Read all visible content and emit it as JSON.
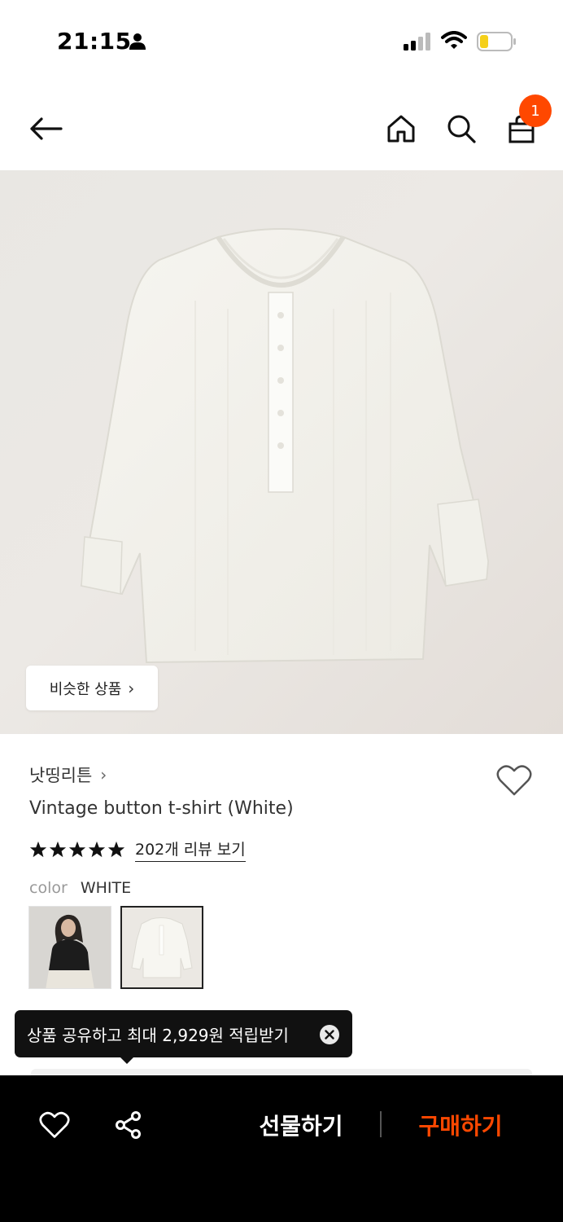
{
  "status_bar": {
    "time": "21:15",
    "icons": [
      "person-icon",
      "signal-icon",
      "wifi-icon",
      "battery-icon"
    ]
  },
  "nav": {
    "icons": [
      "back-arrow-icon",
      "home-icon",
      "search-icon",
      "shopping-bag-icon"
    ],
    "cart_badge": "1"
  },
  "product": {
    "similar_label": "비슷한 상품",
    "brand": "낫띵리튼",
    "title": "Vintage button t-shirt (White)",
    "rating_stars": 5,
    "review_link": "202개 리뷰 보기",
    "color_label": "color",
    "color_value": "WHITE",
    "swatches": [
      "black",
      "white"
    ],
    "selected_swatch": "white"
  },
  "tooltip": {
    "text": "상품 공유하고 최대 2,929원 적립받기"
  },
  "bottom_bar": {
    "gift_label": "선물하기",
    "buy_label": "구매하기"
  },
  "colors": {
    "accent": "#ff4800",
    "bottom_bar_bg": "#000000",
    "tooltip_bg": "#111111"
  }
}
